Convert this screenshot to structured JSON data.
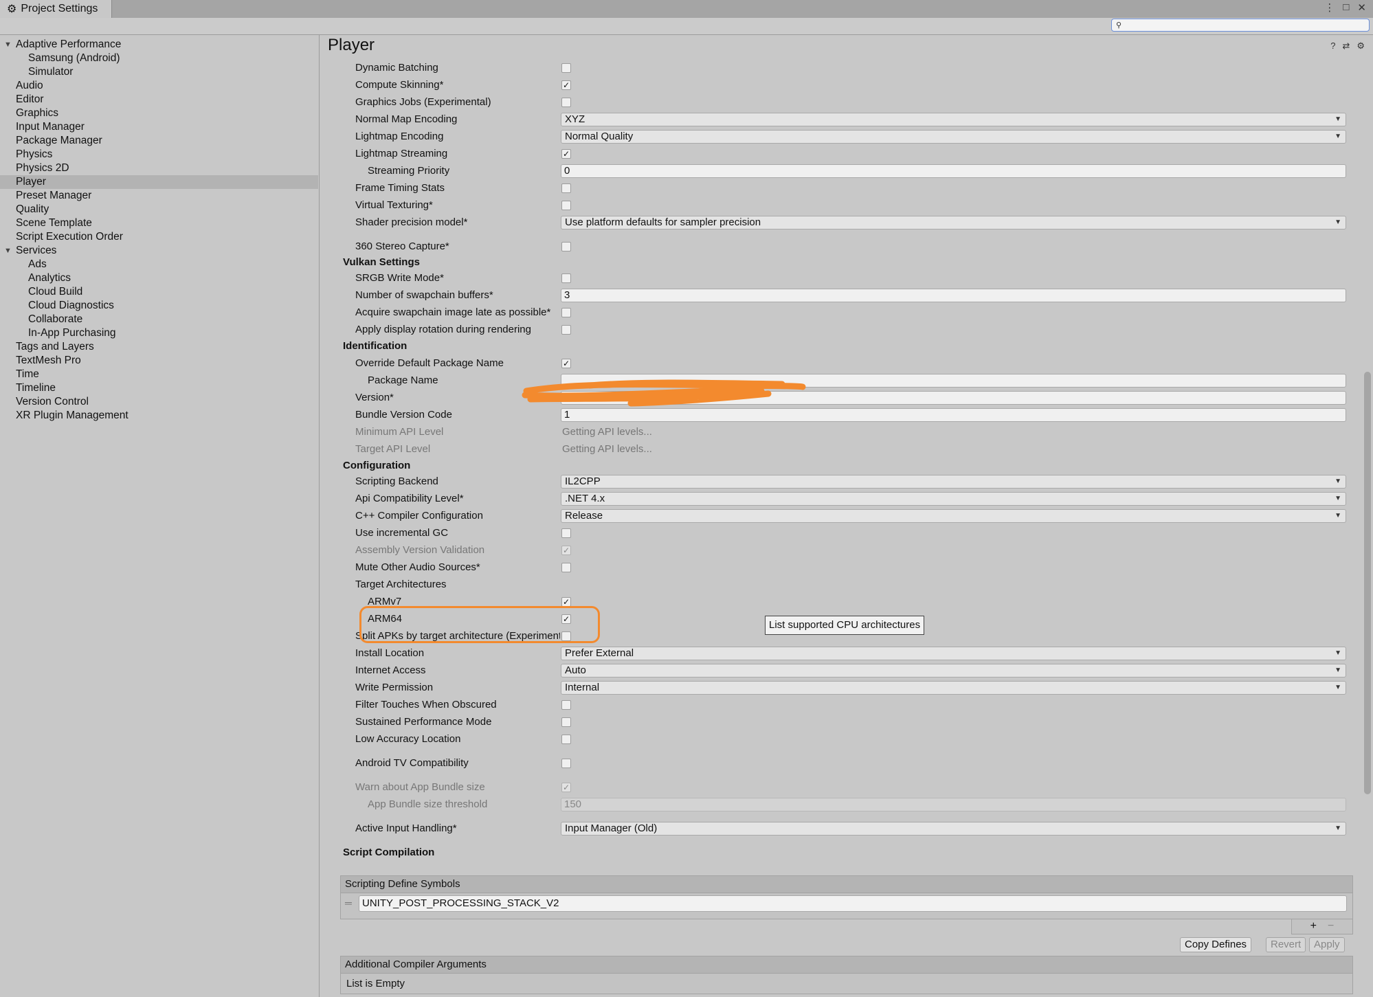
{
  "window": {
    "tab_title": "Project Settings",
    "controls": [
      "⋮",
      "□",
      "✕"
    ]
  },
  "search": {
    "value": "",
    "placeholder": ""
  },
  "sidebar": {
    "items": [
      {
        "label": "Adaptive Performance",
        "expanded": true
      },
      {
        "label": "Samsung (Android)"
      },
      {
        "label": "Simulator"
      },
      {
        "label": "Audio"
      },
      {
        "label": "Editor"
      },
      {
        "label": "Graphics"
      },
      {
        "label": "Input Manager"
      },
      {
        "label": "Package Manager"
      },
      {
        "label": "Physics"
      },
      {
        "label": "Physics 2D"
      },
      {
        "label": "Player",
        "selected": true
      },
      {
        "label": "Preset Manager"
      },
      {
        "label": "Quality"
      },
      {
        "label": "Scene Template"
      },
      {
        "label": "Script Execution Order"
      },
      {
        "label": "Services",
        "expanded": true
      },
      {
        "label": "Ads"
      },
      {
        "label": "Analytics"
      },
      {
        "label": "Cloud Build"
      },
      {
        "label": "Cloud Diagnostics"
      },
      {
        "label": "Collaborate"
      },
      {
        "label": "In-App Purchasing"
      },
      {
        "label": "Tags and Layers"
      },
      {
        "label": "TextMesh Pro"
      },
      {
        "label": "Time"
      },
      {
        "label": "Timeline"
      },
      {
        "label": "Version Control"
      },
      {
        "label": "XR Plugin Management"
      }
    ]
  },
  "main": {
    "title": "Player",
    "rows": {
      "dynamic_batching": "Dynamic Batching",
      "compute_skinning": "Compute Skinning*",
      "graphics_jobs": "Graphics Jobs (Experimental)",
      "normal_map_encoding": "Normal Map Encoding",
      "normal_map_encoding_value": "XYZ",
      "lightmap_encoding": "Lightmap Encoding",
      "lightmap_encoding_value": "Normal Quality",
      "lightmap_streaming": "Lightmap Streaming",
      "streaming_priority": "Streaming Priority",
      "streaming_priority_value": "0",
      "frame_timing_stats": "Frame Timing Stats",
      "virtual_texturing": "Virtual Texturing*",
      "shader_precision": "Shader precision model*",
      "shader_precision_value": "Use platform defaults for sampler precision",
      "stereo_capture": "360 Stereo Capture*",
      "vulkan_header": "Vulkan Settings",
      "srgb_write": "SRGB Write Mode*",
      "swapchain_buffers": "Number of swapchain buffers*",
      "swapchain_buffers_value": "3",
      "acquire_swapchain": "Acquire swapchain image late as possible*",
      "display_rotation": "Apply display rotation during rendering",
      "identification_header": "Identification",
      "override_package": "Override Default Package Name",
      "package_name": "Package Name",
      "package_name_value": "",
      "version": "Version*",
      "version_value": "1.0",
      "bundle_version": "Bundle Version Code",
      "bundle_version_value": "1",
      "min_api": "Minimum API Level",
      "min_api_value": "Getting API levels...",
      "target_api": "Target API Level",
      "target_api_value": "Getting API levels...",
      "configuration_header": "Configuration",
      "scripting_backend": "Scripting Backend",
      "scripting_backend_value": "IL2CPP",
      "api_compat": "Api Compatibility Level*",
      "api_compat_value": ".NET 4.x",
      "cpp_config": "C++ Compiler Configuration",
      "cpp_config_value": "Release",
      "incremental_gc": "Use incremental GC",
      "assembly_validation": "Assembly Version Validation",
      "mute_audio": "Mute Other Audio Sources*",
      "target_arch": "Target Architectures",
      "armv7": "ARMv7",
      "arm64": "ARM64",
      "split_apks": "Split APKs by target architecture (Experimental)",
      "install_location": "Install Location",
      "install_location_value": "Prefer External",
      "internet_access": "Internet Access",
      "internet_access_value": "Auto",
      "write_permission": "Write Permission",
      "write_permission_value": "Internal",
      "filter_touches": "Filter Touches When Obscured",
      "sustained_perf": "Sustained Performance Mode",
      "low_accuracy": "Low Accuracy Location",
      "android_tv": "Android TV Compatibility",
      "warn_bundle": "Warn about App Bundle size",
      "bundle_threshold": "App Bundle size threshold",
      "bundle_threshold_value": "150",
      "active_input": "Active Input Handling*",
      "active_input_value": "Input Manager (Old)",
      "script_compilation_header": "Script Compilation",
      "define_symbols_header": "Scripting Define Symbols",
      "define_symbol_0": "UNITY_POST_PROCESSING_STACK_V2",
      "plus": "+",
      "minus": "−",
      "copy_defines": "Copy Defines",
      "revert": "Revert",
      "apply": "Apply",
      "compiler_args_header": "Additional Compiler Arguments",
      "list_empty": "List is Empty"
    },
    "tooltip": "List supported CPU architectures",
    "checkbox_states": {
      "dynamic_batching": false,
      "compute_skinning": true,
      "graphics_jobs": false,
      "lightmap_streaming": true,
      "frame_timing_stats": false,
      "virtual_texturing": false,
      "stereo_capture": false,
      "srgb_write": false,
      "acquire_swapchain": false,
      "display_rotation": false,
      "override_package": true,
      "incremental_gc": false,
      "assembly_validation": true,
      "mute_audio": false,
      "armv7": true,
      "arm64": true,
      "split_apks": false,
      "filter_touches": false,
      "sustained_perf": false,
      "low_accuracy": false,
      "android_tv": false,
      "warn_bundle": true
    }
  },
  "colors": {
    "highlight": "#f38a2e",
    "background": "#c8c8c8",
    "selection": "#b3b3b3"
  },
  "icons": {
    "tab": "gear-icon",
    "search": "search-icon",
    "help": "help-icon",
    "preset": "preset-icon",
    "settings": "gear-icon"
  }
}
